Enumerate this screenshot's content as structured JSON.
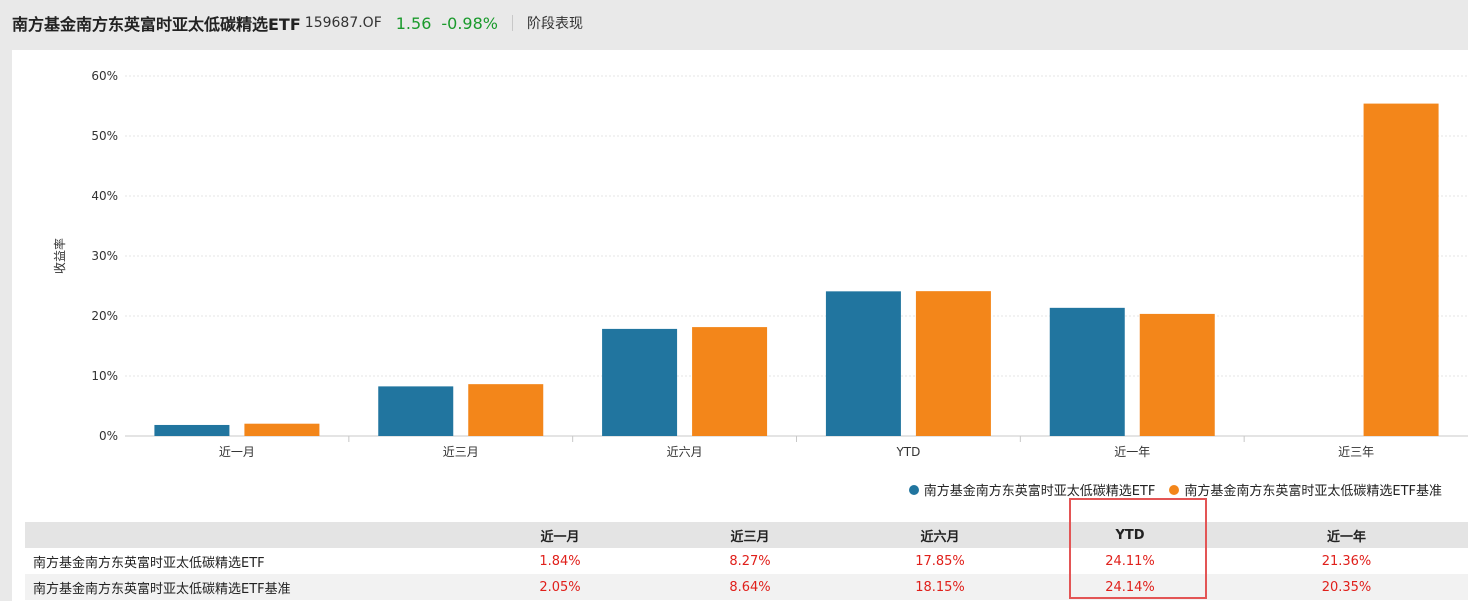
{
  "header": {
    "fund_name": "南方基金南方东英富时亚太低碳精选ETF",
    "fund_code": "159687.OF",
    "price": "1.56",
    "change": "-0.98%",
    "section_tab": "阶段表现"
  },
  "colors": {
    "fund": "#21759f",
    "benchmark": "#f3861a",
    "up": "#e0201b",
    "price_green": "#1a9a2c",
    "highlight": "#e35555"
  },
  "chart_data": {
    "type": "bar",
    "ylabel": "收益率",
    "xlabel": "",
    "ylim": [
      0,
      60
    ],
    "yticks": [
      "0%",
      "10%",
      "20%",
      "30%",
      "40%",
      "50%",
      "60%"
    ],
    "grid": true,
    "legend_position": "bottom-right",
    "categories": [
      "近一月",
      "近三月",
      "近六月",
      "YTD",
      "近一年",
      "近三年"
    ],
    "series": [
      {
        "name": "南方基金南方东英富时亚太低碳精选ETF",
        "values": [
          1.84,
          8.27,
          17.85,
          24.11,
          21.36,
          null
        ]
      },
      {
        "name": "南方基金南方东英富时亚太低碳精选ETF基准",
        "values": [
          2.05,
          8.64,
          18.15,
          24.14,
          20.35,
          55.4
        ]
      }
    ]
  },
  "table": {
    "headers": [
      "",
      "近一月",
      "近三月",
      "近六月",
      "YTD",
      "近一年"
    ],
    "rows": [
      {
        "name": "南方基金南方东英富时亚太低碳精选ETF",
        "values": [
          "1.84%",
          "8.27%",
          "17.85%",
          "24.11%",
          "21.36%"
        ]
      },
      {
        "name": "南方基金南方东英富时亚太低碳精选ETF基准",
        "values": [
          "2.05%",
          "8.64%",
          "18.15%",
          "24.14%",
          "20.35%"
        ]
      }
    ]
  }
}
